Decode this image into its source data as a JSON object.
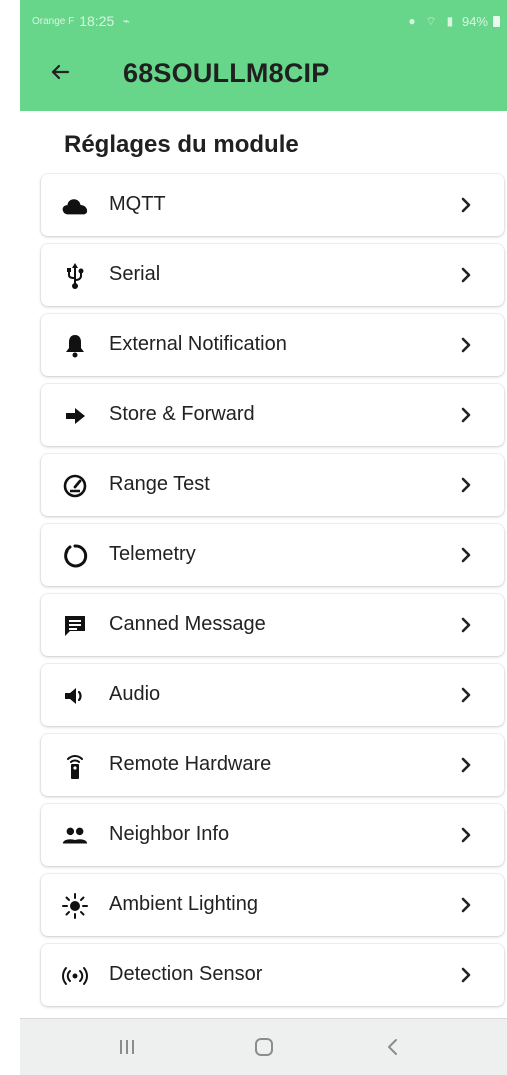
{
  "status_bar": {
    "carrier": "Orange F",
    "time": "18:25",
    "battery": "94%"
  },
  "app_bar": {
    "title": "68SOULLM8CIP",
    "back_icon": "arrow-left-icon"
  },
  "section": {
    "title": "Réglages du module"
  },
  "items": [
    {
      "label": "MQTT",
      "icon": "cloud-icon"
    },
    {
      "label": "Serial",
      "icon": "usb-icon"
    },
    {
      "label": "External Notification",
      "icon": "bell-icon"
    },
    {
      "label": "Store & Forward",
      "icon": "arrow-right-icon"
    },
    {
      "label": "Range Test",
      "icon": "speedometer-icon"
    },
    {
      "label": "Telemetry",
      "icon": "loading-circle-icon"
    },
    {
      "label": "Canned Message",
      "icon": "message-icon"
    },
    {
      "label": "Audio",
      "icon": "volume-icon"
    },
    {
      "label": "Remote Hardware",
      "icon": "remote-icon"
    },
    {
      "label": "Neighbor Info",
      "icon": "people-icon"
    },
    {
      "label": "Ambient Lighting",
      "icon": "light-icon"
    },
    {
      "label": "Detection Sensor",
      "icon": "sensor-icon"
    }
  ],
  "colors": {
    "app_bar": "#67d68a",
    "text": "#222222",
    "navbar": "#eef0ef"
  }
}
